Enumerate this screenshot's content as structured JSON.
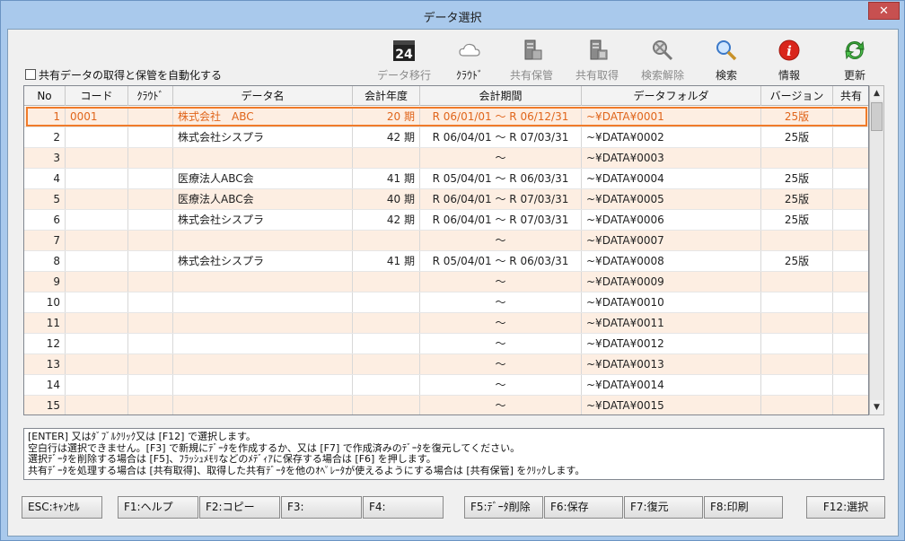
{
  "window": {
    "title": "データ選択",
    "close_glyph": "✕"
  },
  "auto_checkbox": {
    "label": "共有データの取得と保管を自動化する",
    "checked": false
  },
  "toolbar": [
    {
      "key": "migrate",
      "label": "データ移行",
      "icon": "calendar-24-icon",
      "badge": "24",
      "disabled": true
    },
    {
      "key": "cloud",
      "label": "ｸﾗｳﾄﾞ",
      "icon": "cloud-icon",
      "disabled": false
    },
    {
      "key": "share_save",
      "label": "共有保管",
      "icon": "server-save-icon",
      "disabled": true
    },
    {
      "key": "share_get",
      "label": "共有取得",
      "icon": "server-get-icon",
      "disabled": true
    },
    {
      "key": "search_clear",
      "label": "検索解除",
      "icon": "search-clear-icon",
      "disabled": true
    },
    {
      "key": "search",
      "label": "検索",
      "icon": "search-icon",
      "disabled": false
    },
    {
      "key": "info",
      "label": "情報",
      "icon": "info-icon",
      "disabled": false
    },
    {
      "key": "refresh",
      "label": "更新",
      "icon": "refresh-icon",
      "disabled": false
    }
  ],
  "table": {
    "columns": [
      "No",
      "コード",
      "ｸﾗｳﾄﾞ",
      "データ名",
      "会計年度",
      "会計期間",
      "データフォルダ",
      "バージョン",
      "共有"
    ],
    "rows": [
      {
        "no": "1",
        "code": "0001",
        "cloud": "",
        "name": "株式会社　ABC",
        "year": "20 期",
        "period": "R 06/01/01 ～ R 06/12/31",
        "folder": "~¥DATA¥0001",
        "version": "25版",
        "share": ""
      },
      {
        "no": "2",
        "code": "",
        "cloud": "",
        "name": "株式会社シスプラ",
        "year": "42 期",
        "period": "R 06/04/01 ～ R 07/03/31",
        "folder": "~¥DATA¥0002",
        "version": "25版",
        "share": ""
      },
      {
        "no": "3",
        "code": "",
        "cloud": "",
        "name": "",
        "year": "",
        "period": "～",
        "folder": "~¥DATA¥0003",
        "version": "",
        "share": ""
      },
      {
        "no": "4",
        "code": "",
        "cloud": "",
        "name": "医療法人ABC会",
        "year": "41 期",
        "period": "R 05/04/01 ～ R 06/03/31",
        "folder": "~¥DATA¥0004",
        "version": "25版",
        "share": ""
      },
      {
        "no": "5",
        "code": "",
        "cloud": "",
        "name": "医療法人ABC会",
        "year": "40 期",
        "period": "R 06/04/01 ～ R 07/03/31",
        "folder": "~¥DATA¥0005",
        "version": "25版",
        "share": ""
      },
      {
        "no": "6",
        "code": "",
        "cloud": "",
        "name": "株式会社シスプラ",
        "year": "42 期",
        "period": "R 06/04/01 ～ R 07/03/31",
        "folder": "~¥DATA¥0006",
        "version": "25版",
        "share": ""
      },
      {
        "no": "7",
        "code": "",
        "cloud": "",
        "name": "",
        "year": "",
        "period": "～",
        "folder": "~¥DATA¥0007",
        "version": "",
        "share": ""
      },
      {
        "no": "8",
        "code": "",
        "cloud": "",
        "name": "株式会社シスプラ",
        "year": "41 期",
        "period": "R 05/04/01 ～ R 06/03/31",
        "folder": "~¥DATA¥0008",
        "version": "25版",
        "share": ""
      },
      {
        "no": "9",
        "code": "",
        "cloud": "",
        "name": "",
        "year": "",
        "period": "～",
        "folder": "~¥DATA¥0009",
        "version": "",
        "share": ""
      },
      {
        "no": "10",
        "code": "",
        "cloud": "",
        "name": "",
        "year": "",
        "period": "～",
        "folder": "~¥DATA¥0010",
        "version": "",
        "share": ""
      },
      {
        "no": "11",
        "code": "",
        "cloud": "",
        "name": "",
        "year": "",
        "period": "～",
        "folder": "~¥DATA¥0011",
        "version": "",
        "share": ""
      },
      {
        "no": "12",
        "code": "",
        "cloud": "",
        "name": "",
        "year": "",
        "period": "～",
        "folder": "~¥DATA¥0012",
        "version": "",
        "share": ""
      },
      {
        "no": "13",
        "code": "",
        "cloud": "",
        "name": "",
        "year": "",
        "period": "～",
        "folder": "~¥DATA¥0013",
        "version": "",
        "share": ""
      },
      {
        "no": "14",
        "code": "",
        "cloud": "",
        "name": "",
        "year": "",
        "period": "～",
        "folder": "~¥DATA¥0014",
        "version": "",
        "share": ""
      },
      {
        "no": "15",
        "code": "",
        "cloud": "",
        "name": "",
        "year": "",
        "period": "～",
        "folder": "~¥DATA¥0015",
        "version": "",
        "share": ""
      }
    ],
    "selected_row": 0
  },
  "messages": [
    "[ENTER] 又はﾀﾞﾌﾞﾙｸﾘｯｸ又は [F12] で選択します。",
    "空白行は選択できません。[F3] で新規にﾃﾞｰﾀを作成するか、又は [F7] で作成済みのﾃﾞｰﾀを復元してください。",
    "選択ﾃﾞｰﾀを削除する場合は [F5]、ﾌﾗｯｼｭﾒﾓﾘなどのﾒﾃﾞｨｱに保存する場合は [F6] を押します。",
    "共有ﾃﾞｰﾀを処理する場合は [共有取得]、取得した共有ﾃﾞｰﾀを他のｵﾍﾟﾚｰﾀが使えるようにする場合は [共有保管] をｸﾘｯｸします。"
  ],
  "function_keys": [
    {
      "key": "esc",
      "label": "ESC:ｷｬﾝｾﾙ"
    },
    {
      "key": "f1",
      "label": "F1:ヘルプ"
    },
    {
      "key": "f2",
      "label": "F2:コピー"
    },
    {
      "key": "f3",
      "label": "F3:"
    },
    {
      "key": "f4",
      "label": "F4:"
    },
    {
      "key": "f5",
      "label": "F5:ﾃﾞｰﾀ削除"
    },
    {
      "key": "f6",
      "label": "F6:保存"
    },
    {
      "key": "f7",
      "label": "F7:復元"
    },
    {
      "key": "f8",
      "label": "F8:印刷"
    },
    {
      "key": "f12",
      "label": "F12:選択"
    }
  ],
  "colors": {
    "accent": "#f07b2a",
    "alt_row": "#fdeee2",
    "selected_text": "#e0651b",
    "close": "#c75050"
  }
}
